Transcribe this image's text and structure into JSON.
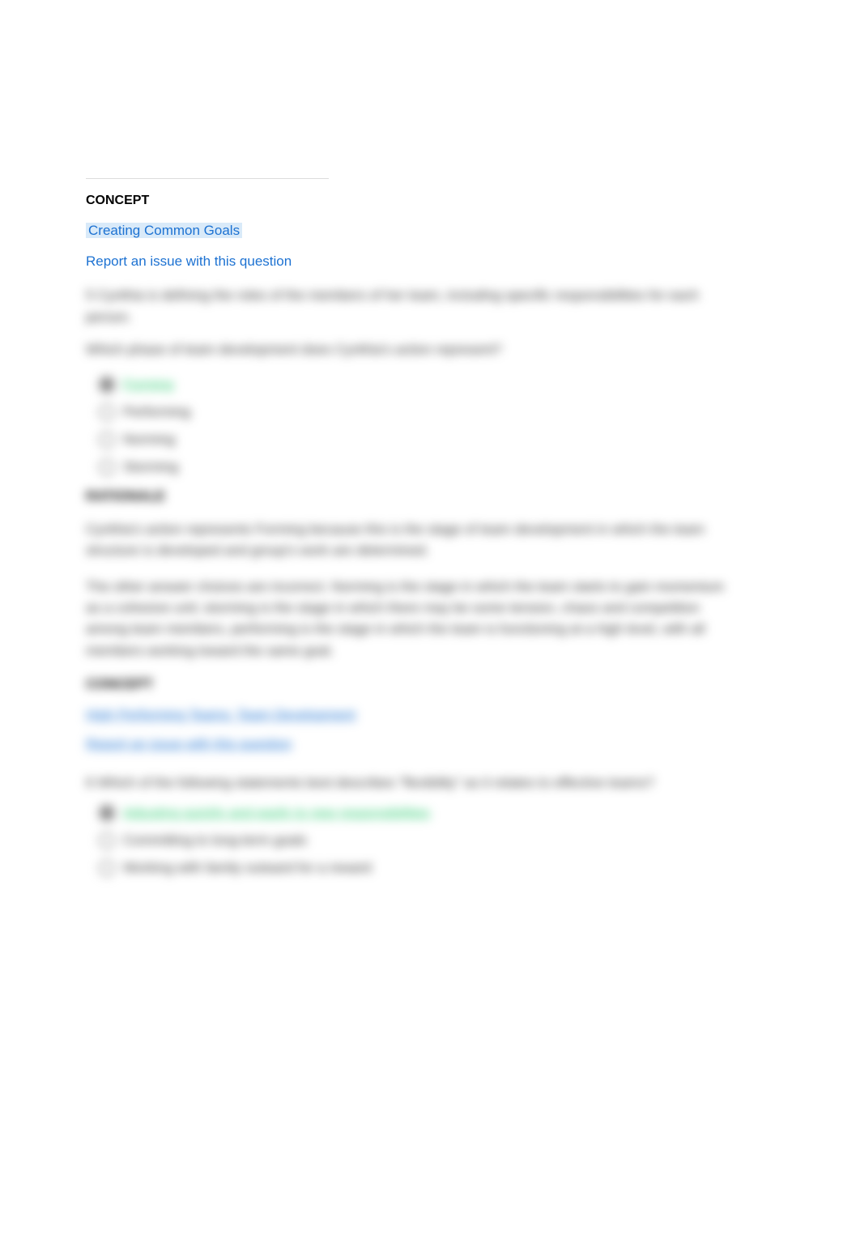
{
  "concept": {
    "label": "CONCEPT",
    "link": "Creating Common Goals",
    "report": "Report an issue with this question"
  },
  "q1": {
    "number": "5",
    "prompt_prefix": "Cynthia is defining the roles of the members of her team, including specific responsibilities for each person.",
    "prompt": "Which phase of team development does Cynthia's action represent?",
    "options": [
      {
        "label": "Forming",
        "correct": true,
        "selected": true
      },
      {
        "label": "Performing",
        "correct": false,
        "selected": false
      },
      {
        "label": "Norming",
        "correct": false,
        "selected": false
      },
      {
        "label": "Storming",
        "correct": false,
        "selected": false
      }
    ],
    "rationale_label": "RATIONALE",
    "rationale_p1": "Cynthia's action represents Forming because this is the stage of team development in which the team structure is developed and group's work are determined.",
    "rationale_p2": "The other answer choices are incorrect. Norming is the stage in which the team starts to gain momentum as a cohesive unit; storming is the stage in which there may be some tension, chaos and competition among team members, performing is the stage in which the team is functioning at a high level, with all members working toward the same goal.",
    "concept_label": "CONCEPT",
    "concept_link": "High Performing Teams: Team Development",
    "report": "Report an issue with this question"
  },
  "q2": {
    "number": "6",
    "prompt": "Which of the following statements best describes \"flexibility\" as it relates to effective teams?",
    "options": [
      {
        "label": "Adjusting quickly and easily to new responsibilities",
        "correct": true,
        "selected": true
      },
      {
        "label": "Committing to long-term goals",
        "correct": false,
        "selected": false
      },
      {
        "label": "Working with family outward for a reward",
        "correct": false,
        "selected": false
      }
    ]
  }
}
